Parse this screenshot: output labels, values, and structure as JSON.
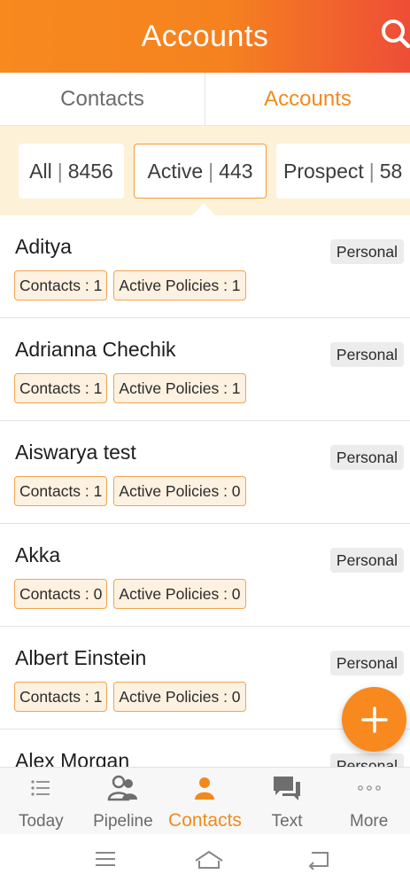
{
  "header": {
    "title": "Accounts",
    "search_icon": "search-icon"
  },
  "tabs": [
    {
      "label": "Contacts",
      "active": false
    },
    {
      "label": "Accounts",
      "active": true
    }
  ],
  "filters": [
    {
      "label": "All",
      "count": "8456",
      "selected": false
    },
    {
      "label": "Active",
      "count": "443",
      "selected": true
    },
    {
      "label": "Prospect",
      "count": "58",
      "selected": false
    }
  ],
  "accounts": [
    {
      "name": "Aditya",
      "type": "Personal",
      "contacts": "Contacts : 1",
      "policies": "Active Policies : 1"
    },
    {
      "name": "Adrianna Chechik",
      "type": "Personal",
      "contacts": "Contacts : 1",
      "policies": "Active Policies : 1"
    },
    {
      "name": "Aiswarya test",
      "type": "Personal",
      "contacts": "Contacts : 1",
      "policies": "Active Policies : 0"
    },
    {
      "name": "Akka",
      "type": "Personal",
      "contacts": "Contacts : 0",
      "policies": "Active Policies : 0"
    },
    {
      "name": "Albert Einstein",
      "type": "Personal",
      "contacts": "Contacts : 1",
      "policies": "Active Policies : 0"
    },
    {
      "name": "Alex Morgan",
      "type": "Personal",
      "contacts": "",
      "policies": ""
    }
  ],
  "fab": {
    "icon": "plus-icon"
  },
  "bottom_nav": [
    {
      "label": "Today",
      "icon": "list-icon",
      "active": false
    },
    {
      "label": "Pipeline",
      "icon": "people-icon",
      "active": false
    },
    {
      "label": "Contacts",
      "icon": "person-icon",
      "active": true
    },
    {
      "label": "Text",
      "icon": "chat-icon",
      "active": false
    },
    {
      "label": "More",
      "icon": "more-dots-icon",
      "active": false
    }
  ],
  "system_nav": [
    "menu-icon",
    "home-icon",
    "back-icon"
  ],
  "colors": {
    "accent": "#f7891f",
    "header_end": "#ee4d37",
    "filter_bg": "#fdf1d8",
    "pill_border": "#f2a451"
  }
}
